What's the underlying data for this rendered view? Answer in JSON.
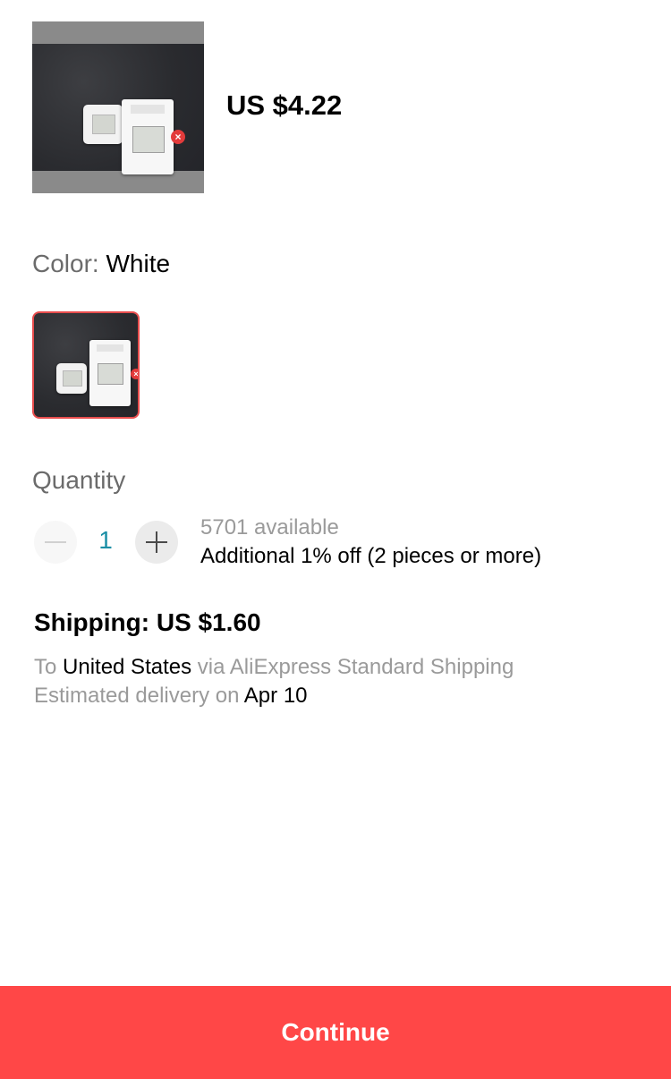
{
  "product": {
    "price": "US $4.22",
    "image_icon": "product-photo-icon"
  },
  "color": {
    "label": "Color: ",
    "selected": "White",
    "options": [
      {
        "name": "White",
        "icon": "product-swatch-icon"
      }
    ]
  },
  "quantity": {
    "title": "Quantity",
    "value": "1",
    "available": "5701 available",
    "discount": "Additional 1% off (2 pieces or more)"
  },
  "shipping": {
    "title": "Shipping: US $1.60",
    "to_prefix": "To ",
    "country": "United States",
    "via": " via AliExpress Standard Shipping",
    "delivery_prefix": "Estimated delivery on ",
    "delivery_date": "Apr 10"
  },
  "footer": {
    "continue_label": "Continue",
    "accent": "#ff4747"
  }
}
